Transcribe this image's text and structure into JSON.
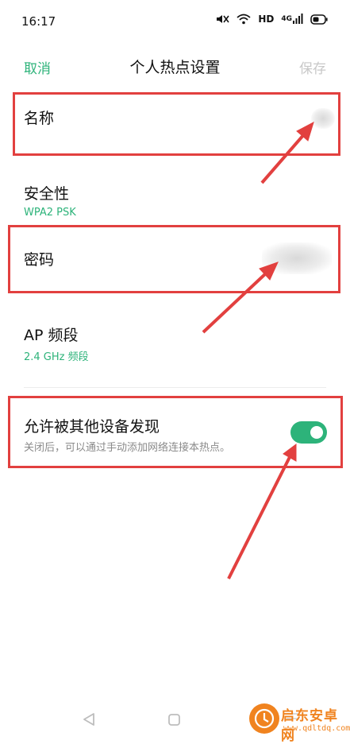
{
  "status_bar": {
    "time": "16:17",
    "network_label": "HD",
    "signal_label": "4G",
    "icons": [
      "mute-icon",
      "wifi-icon",
      "signal-icon",
      "battery-icon"
    ]
  },
  "header": {
    "cancel_label": "取消",
    "title": "个人热点设置",
    "save_label": "保存"
  },
  "settings": {
    "name": {
      "label": "名称",
      "value": ""
    },
    "security": {
      "label": "安全性",
      "value": "WPA2 PSK"
    },
    "password": {
      "label": "密码",
      "value": ""
    },
    "band": {
      "label": "AP 频段",
      "value": "2.4 GHz 频段"
    },
    "discover": {
      "label": "允许被其他设备发现",
      "description": "关闭后，可以通过手动添加网络连接本热点。",
      "enabled": true
    }
  },
  "watermark": {
    "text": "启东安卓网",
    "url": "www.qdltdq.com"
  },
  "colors": {
    "accent": "#2db37a",
    "annotation_red": "#e2403f",
    "disabled": "#c8c8c8",
    "watermark_orange": "#f0831f"
  }
}
